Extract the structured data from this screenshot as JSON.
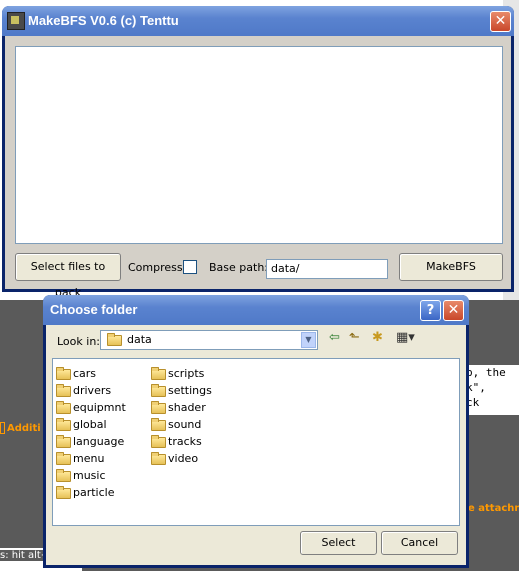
{
  "background": {
    "right_text_lines": [
      "p, the",
      "k\",",
      "ck"
    ],
    "left_orange_text": "Additi",
    "right_orange_text": "e attachn",
    "bottom_status": "s: hit alt+"
  },
  "main_window": {
    "title": "MakeBFS V0.6  (c) Tenttu",
    "close_glyph": "✕",
    "select_files_label": "Select files to pack",
    "compress_label": "Compress",
    "base_path_label": "Base path:",
    "base_path_value": "data/",
    "make_label": "MakeBFS"
  },
  "dialog": {
    "title": "Choose folder",
    "help_glyph": "?",
    "close_glyph": "✕",
    "look_in_label": "Look in:",
    "look_in_value": "data",
    "folders_col1": [
      "cars",
      "drivers",
      "equipmnt",
      "global",
      "language",
      "menu",
      "music",
      "particle"
    ],
    "folders_col2": [
      "scripts",
      "settings",
      "shader",
      "sound",
      "tracks",
      "video"
    ],
    "select_label": "Select",
    "cancel_label": "Cancel"
  },
  "colors": {
    "titlebar": "#5a83cf",
    "window_frame": "#0a246a",
    "close_red": "#c9472a",
    "orange_text": "#ff9900"
  }
}
